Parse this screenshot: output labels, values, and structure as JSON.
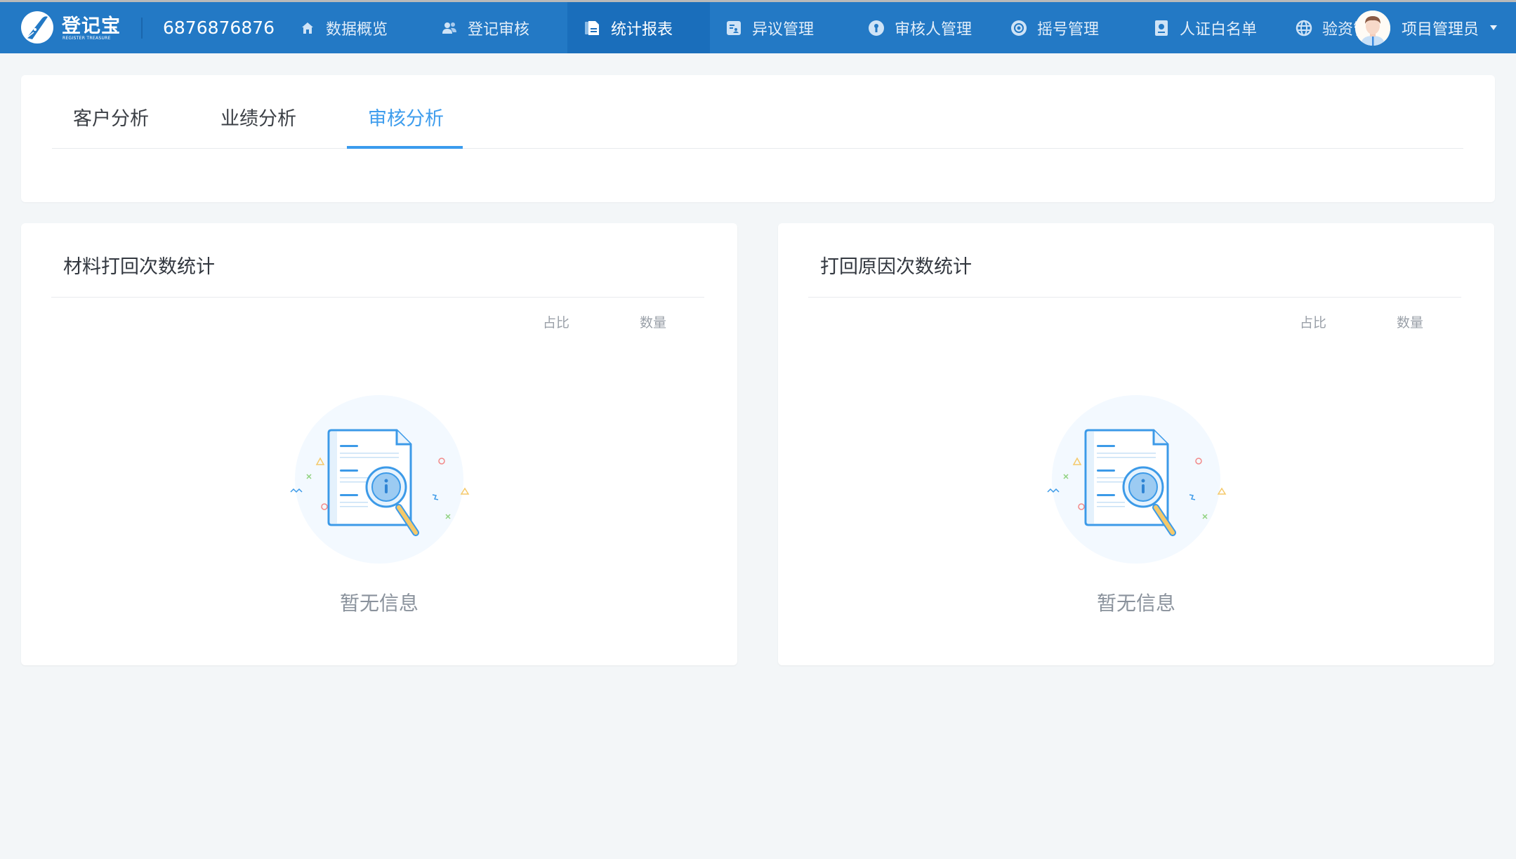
{
  "brand": {
    "name": "登记宝",
    "subtitle": "REGISTER TREASURE",
    "account_number": "6876876876"
  },
  "nav": {
    "items": [
      {
        "label": "数据概览",
        "icon": "home-icon",
        "active": false
      },
      {
        "label": "登记审核",
        "icon": "users-icon",
        "active": false
      },
      {
        "label": "统计报表",
        "icon": "document-icon",
        "active": true
      },
      {
        "label": "异议管理",
        "icon": "id-card-icon",
        "active": false
      },
      {
        "label": "审核人管理",
        "icon": "keyhole-icon",
        "active": false
      },
      {
        "label": "摇号管理",
        "icon": "target-icon",
        "active": false
      },
      {
        "label": "人证白名单",
        "icon": "badge-icon",
        "active": false
      },
      {
        "label": "验资管理",
        "icon": "globe-icon",
        "active": false
      }
    ]
  },
  "user": {
    "name": "项目管理员",
    "avatar": "user-avatar"
  },
  "tabs": {
    "items": [
      {
        "label": "客户分析",
        "active": false
      },
      {
        "label": "业绩分析",
        "active": false
      },
      {
        "label": "审核分析",
        "active": true
      }
    ]
  },
  "cards": [
    {
      "title": "材料打回次数统计",
      "columns": [
        "占比",
        "数量"
      ],
      "rows": [],
      "empty_text": "暂无信息"
    },
    {
      "title": "打回原因次数统计",
      "columns": [
        "占比",
        "数量"
      ],
      "rows": [],
      "empty_text": "暂无信息"
    }
  ],
  "colors": {
    "nav_bg": "#2379c5",
    "nav_active": "#1a6ebb",
    "accent": "#3a9bee",
    "page_bg": "#f3f6f8"
  }
}
